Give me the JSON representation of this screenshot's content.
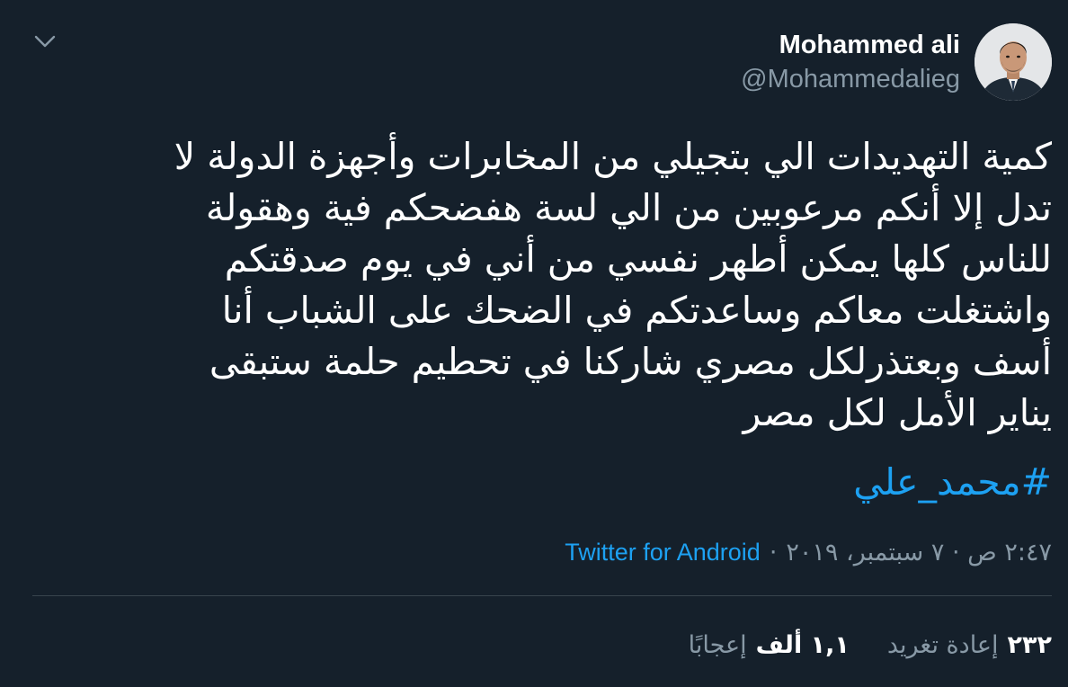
{
  "colors": {
    "background": "#15202b",
    "primary_text": "#ffffff",
    "secondary_text": "#8899a6",
    "link": "#1da1f2",
    "divider": "#38444d"
  },
  "tweet": {
    "author": {
      "display_name": "Mohammed ali",
      "handle": "@Mohammedalieg",
      "avatar_icon": "profile-photo"
    },
    "menu_icon": "chevron-down-icon",
    "text_lines": [
      "كمية التهديدات الي بتجيلي من المخابرات وأجهزة الدولة لا",
      "تدل إلا أنكم مرعوبين من الي لسة هفضحكم فية وهقولة",
      "للناس كلها يمكن أطهر نفسي من أني في يوم صدقتكم",
      "واشتغلت معاكم وساعدتكم في الضحك على الشباب أنا",
      "أسف وبعتذرلكل مصري شاركنا في تحطيم حلمة ستبقى",
      "يناير الأمل لكل مصر"
    ],
    "hashtag": "#محمد_علي",
    "timestamp": "٢:٤٧ ص · ٧ سبتمبر، ٢٠١٩",
    "separator": "·",
    "source": "Twitter for Android",
    "stats": {
      "retweets_count": "٢٣٢",
      "retweets_label": "إعادة تغريد",
      "likes_count": "١,١ ألف",
      "likes_label": "إعجابًا"
    }
  }
}
